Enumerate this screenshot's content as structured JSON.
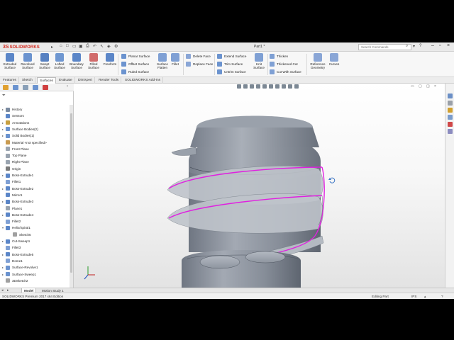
{
  "app": {
    "logo_ds": "3S",
    "logo_text": "SOLIDWORKS",
    "doc_title": "Part1 *",
    "search_placeholder": "Search Commands"
  },
  "ribbon": {
    "large_buttons": [
      {
        "label": "Extruded\nSurface",
        "icon": "extruded-surface-icon",
        "color": "#3a74c4"
      },
      {
        "label": "Revolved\nSurface",
        "icon": "revolved-surface-icon",
        "color": "#3a74c4"
      },
      {
        "label": "Swept\nSurface",
        "icon": "swept-surface-icon",
        "color": "#3a74c4"
      },
      {
        "label": "Lofted\nSurface",
        "icon": "lofted-surface-icon",
        "color": "#3a74c4"
      },
      {
        "label": "Boundary\nSurface",
        "icon": "boundary-surface-icon",
        "color": "#3a74c4"
      },
      {
        "label": "Filled\nSurface",
        "icon": "filled-surface-icon",
        "color": "#3a74c4"
      },
      {
        "label": "Freeform",
        "icon": "freeform-icon",
        "color": "#3a74c4"
      }
    ],
    "group1": [
      "Planar Surface",
      "Offset Surface",
      "Ruled Surface"
    ],
    "surface_flatten": "Surface\nFlatten",
    "fillet": "Fillet",
    "group2": [
      "Delete Face",
      "Replace Face"
    ],
    "group3": [
      "Extend Surface",
      "Trim Surface",
      "Untrim Surface"
    ],
    "knit": "Knit\nSurface",
    "group4": [
      "Thicken",
      "Thickened Cut",
      "Cut With Surface"
    ],
    "reference_geometry": "Reference\nGeometry",
    "curves": "Curves"
  },
  "tabs": [
    "Features",
    "Sketch",
    "Surfaces",
    "Evaluate",
    "DimXpert",
    "Render Tools",
    "SOLIDWORKS Add-Ins"
  ],
  "active_tab": "Surfaces",
  "tree": [
    {
      "label": "History",
      "expand": "▸",
      "icon": "history-icon"
    },
    {
      "label": "Sensors",
      "expand": "",
      "icon": "sensors-icon"
    },
    {
      "label": "Annotations",
      "expand": "▸",
      "icon": "annotations-icon"
    },
    {
      "label": "Surface Bodies(2)",
      "expand": "▸",
      "icon": "surface-bodies-icon"
    },
    {
      "label": "Solid Bodies(1)",
      "expand": "▸",
      "icon": "solid-bodies-icon"
    },
    {
      "label": "Material <not specified>",
      "expand": "",
      "icon": "material-icon"
    },
    {
      "label": "Front Plane",
      "expand": "",
      "icon": "plane-icon"
    },
    {
      "label": "Top Plane",
      "expand": "",
      "icon": "plane-icon"
    },
    {
      "label": "Right Plane",
      "expand": "",
      "icon": "plane-icon"
    },
    {
      "label": "Origin",
      "expand": "",
      "icon": "origin-icon"
    },
    {
      "label": "Boss-Extrude1",
      "expand": "▸",
      "icon": "boss-extrude-icon"
    },
    {
      "label": "Fillet1",
      "expand": "",
      "icon": "fillet-icon"
    },
    {
      "label": "Boss-Extrude2",
      "expand": "▸",
      "icon": "boss-extrude-icon"
    },
    {
      "label": "Mirror1",
      "expand": "",
      "icon": "mirror-icon"
    },
    {
      "label": "Boss-Extrude3",
      "expand": "▸",
      "icon": "boss-extrude-icon"
    },
    {
      "label": "Plane1",
      "expand": "",
      "icon": "plane-icon"
    },
    {
      "label": "Boss-Extrude4",
      "expand": "▸",
      "icon": "boss-extrude-icon"
    },
    {
      "label": "Fillet2",
      "expand": "",
      "icon": "fillet-icon"
    },
    {
      "label": "Helix/Spiral1",
      "expand": "▾",
      "icon": "helix-icon"
    },
    {
      "label": "Sketch5",
      "expand": "",
      "icon": "sketch-icon",
      "indent": true
    },
    {
      "label": "Cut-Sweep1",
      "expand": "▸",
      "icon": "cut-sweep-icon"
    },
    {
      "label": "Fillet3",
      "expand": "",
      "icon": "fillet-icon"
    },
    {
      "label": "Boss-Extrude5",
      "expand": "▸",
      "icon": "boss-extrude-icon"
    },
    {
      "label": "Dome1",
      "expand": "",
      "icon": "dome-icon"
    },
    {
      "label": "Surface-Revolve1",
      "expand": "▸",
      "icon": "surface-revolve-icon"
    },
    {
      "label": "Surface-Sweep1",
      "expand": "▸",
      "icon": "surface-sweep-icon"
    },
    {
      "label": "3DSketch2",
      "expand": "",
      "icon": "3dsketch-icon"
    }
  ],
  "bottom_tabs": [
    "Model",
    "Motion Study 1"
  ],
  "status": {
    "left": "SOLIDWORKS Premium 2017 x64 Edition",
    "editing": "Editing Part",
    "units": "IPS"
  },
  "colors": {
    "model_fill": "#8a919c",
    "highlight": "#e020e0",
    "accent": "#3a74c4"
  }
}
